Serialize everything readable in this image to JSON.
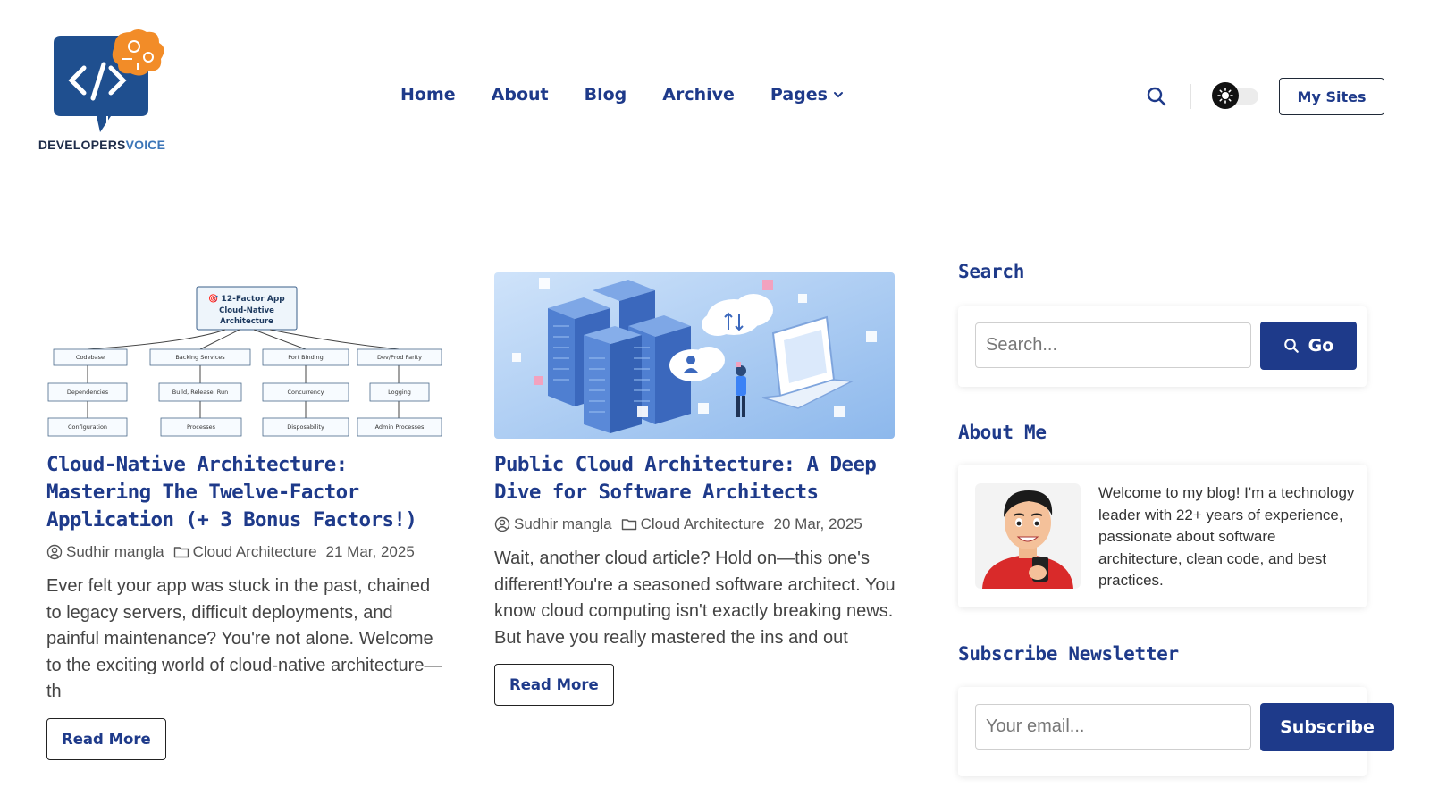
{
  "brand": {
    "name_part1": "DEVELOPERS",
    "name_part2": "VOICE"
  },
  "nav": {
    "items": [
      {
        "label": "Home"
      },
      {
        "label": "About"
      },
      {
        "label": "Blog"
      },
      {
        "label": "Archive"
      },
      {
        "label": "Pages",
        "has_dropdown": true
      }
    ]
  },
  "header": {
    "my_sites_label": "My Sites",
    "theme_toggle": "light"
  },
  "posts": [
    {
      "title": "Cloud-Native Architecture: Mastering The Twelve-Factor Application (+ 3 Bonus Factors!)",
      "author": "Sudhir mangla",
      "category": "Cloud Architecture",
      "date": "21 Mar, 2025",
      "excerpt": "Ever felt your app was stuck in the past, chained to legacy servers, difficult deployments, and painful maintenance? You're not alone. Welcome to the exciting world of cloud-native architecture—th",
      "read_more": "Read More",
      "diagram": {
        "root": "12-Factor App Cloud-Native Architecture",
        "nodes": [
          "Codebase",
          "Backing Services",
          "Port Binding",
          "Dev/Prod Parity",
          "Dependencies",
          "Build, Release, Run",
          "Concurrency",
          "Logging",
          "Configuration",
          "Processes",
          "Disposability",
          "Admin Processes"
        ]
      }
    },
    {
      "title": "Public Cloud Architecture: A Deep Dive for Software Architects",
      "author": "Sudhir mangla",
      "category": "Cloud Architecture",
      "date": "20 Mar, 2025",
      "excerpt": "Wait, another cloud article? Hold on—this one's different!You're a seasoned software architect. You know cloud computing isn't exactly breaking news. But have you really mastered the ins and out",
      "read_more": "Read More"
    }
  ],
  "sidebar": {
    "search": {
      "heading": "Search",
      "placeholder": "Search...",
      "button": "Go"
    },
    "about": {
      "heading": "About Me",
      "text": "Welcome to my blog! I'm a technology leader with 22+ years of experience, passionate about software architecture, clean code, and best practices."
    },
    "newsletter": {
      "heading": "Subscribe Newsletter",
      "placeholder": "Your email...",
      "button": "Subscribe"
    }
  },
  "colors": {
    "accent": "#1e3a8a",
    "text": "#444444",
    "logo_orange": "#f28c28",
    "logo_blue": "#1f4f8f"
  }
}
